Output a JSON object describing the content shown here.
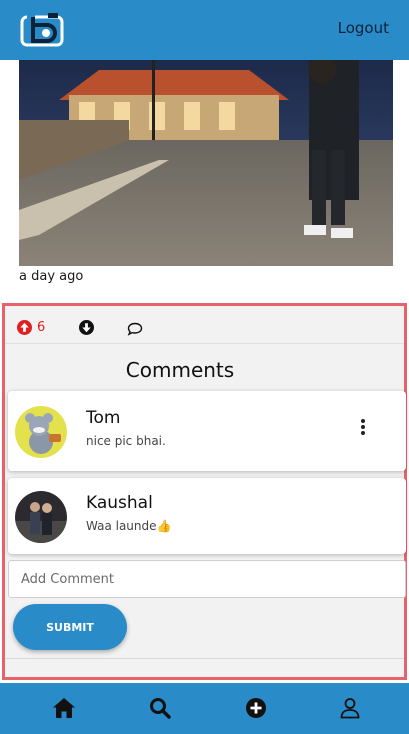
{
  "header": {
    "logout_label": "Logout",
    "logo_icon": "camera-logo-icon",
    "accent_color": "#2a8bc9"
  },
  "post": {
    "time_ago": "a day ago"
  },
  "actions": {
    "upvote_count": "6",
    "upvote_color": "#e02020"
  },
  "comments": {
    "title": "Comments",
    "items": [
      {
        "name": "Tom",
        "text": "nice pic bhai."
      },
      {
        "name": "Kaushal",
        "text": "Waa launde👍"
      }
    ],
    "add_placeholder": "Add Comment",
    "submit_label": "SUBMIT"
  },
  "bottom_nav": {
    "icons": [
      "home-icon",
      "search-icon",
      "add-icon",
      "profile-icon"
    ]
  }
}
